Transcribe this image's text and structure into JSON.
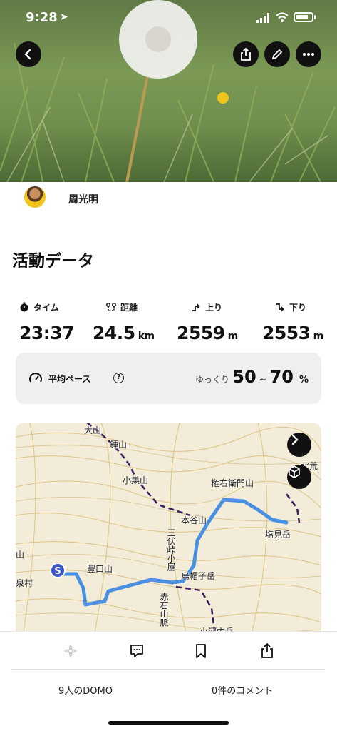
{
  "status_bar": {
    "time": "9:28"
  },
  "header": {
    "back_icon": "chevron-left-icon",
    "actions": [
      "share-icon",
      "edit-pencil-icon",
      "more-icon"
    ]
  },
  "profile": {
    "name": "周光明"
  },
  "activity": {
    "title": "活動データ",
    "stats": [
      {
        "label": "タイム",
        "value": "23:37",
        "unit": "",
        "icon": "stopwatch-icon"
      },
      {
        "label": "距離",
        "value": "24.5",
        "unit": "km",
        "icon": "route-icon"
      },
      {
        "label": "上り",
        "value": "2559",
        "unit": "m",
        "icon": "ascent-icon"
      },
      {
        "label": "下り",
        "value": "2553",
        "unit": "m",
        "icon": "descent-icon"
      }
    ],
    "pace": {
      "label": "平均ペース",
      "sub": "ゆっくり",
      "min": "50",
      "tilde": "~",
      "max": "70",
      "unit": "%"
    }
  },
  "map": {
    "labels": {
      "l1": "大山",
      "l2": "鍾山",
      "l3": "小巣山",
      "l4": "権右衛門山",
      "l5": "本谷山",
      "l6": "塩見岳",
      "l7": "三伏峠小屋",
      "l8": "豐口山",
      "l9": "烏帽子岳",
      "l10": "赤石山脈",
      "l11": "小河内岳",
      "l12": "泉村",
      "l13": "山",
      "l14": "北荒川"
    },
    "start_marker": "S",
    "route_color": "#4a90e2"
  },
  "footer": {
    "domo_count": "9人のDOMO",
    "comment_count": "0件のコメント"
  }
}
